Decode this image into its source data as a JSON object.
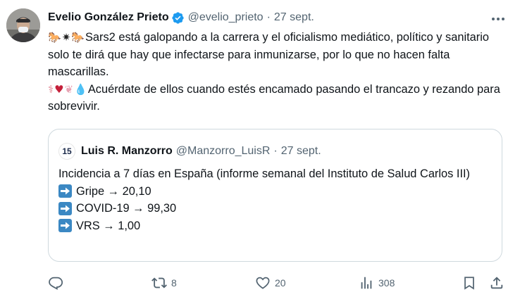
{
  "tweet": {
    "author_name": "Evelio González Prieto",
    "author_handle": "@evelio_prieto",
    "separator": "·",
    "timestamp": "27 sept.",
    "line1_text": "Sars2 está galopando a la carrera y el oficialismo mediático, político y sanitario solo te dirá que hay que infectarse para inmunizarse, por lo que no hacen falta mascarillas.",
    "line2_text": "Acuérdate de ellos cuando estés encamado pasando el trancazo y rezando para sobrevivir.",
    "emojis_line1": [
      "horse",
      "explosion",
      "horse"
    ],
    "emojis_line2": [
      "lungs",
      "anatomical-heart",
      "brain",
      "drop-of-blood"
    ]
  },
  "quote": {
    "author_name": "Luis R. Manzorro",
    "author_handle": "@Manzorro_LuisR",
    "separator": "·",
    "timestamp": "27 sept.",
    "avatar_text": "15",
    "intro": "Incidencia a 7 días en España (informe semanal del Instituto de Salud Carlos III)",
    "items": [
      {
        "label": "Gripe → 20,10"
      },
      {
        "label": "COVID-19 → 99,30"
      },
      {
        "label": "VRS → 1,00"
      }
    ]
  },
  "actions": {
    "reply_count": "",
    "retweet_count": "8",
    "like_count": "20",
    "views_count": "308"
  },
  "colors": {
    "text": "#0f1419",
    "secondary": "#536471",
    "verified_blue": "#1d9bf0",
    "border": "#cfd9de",
    "arrow_emoji_bg": "#3b88c3"
  }
}
